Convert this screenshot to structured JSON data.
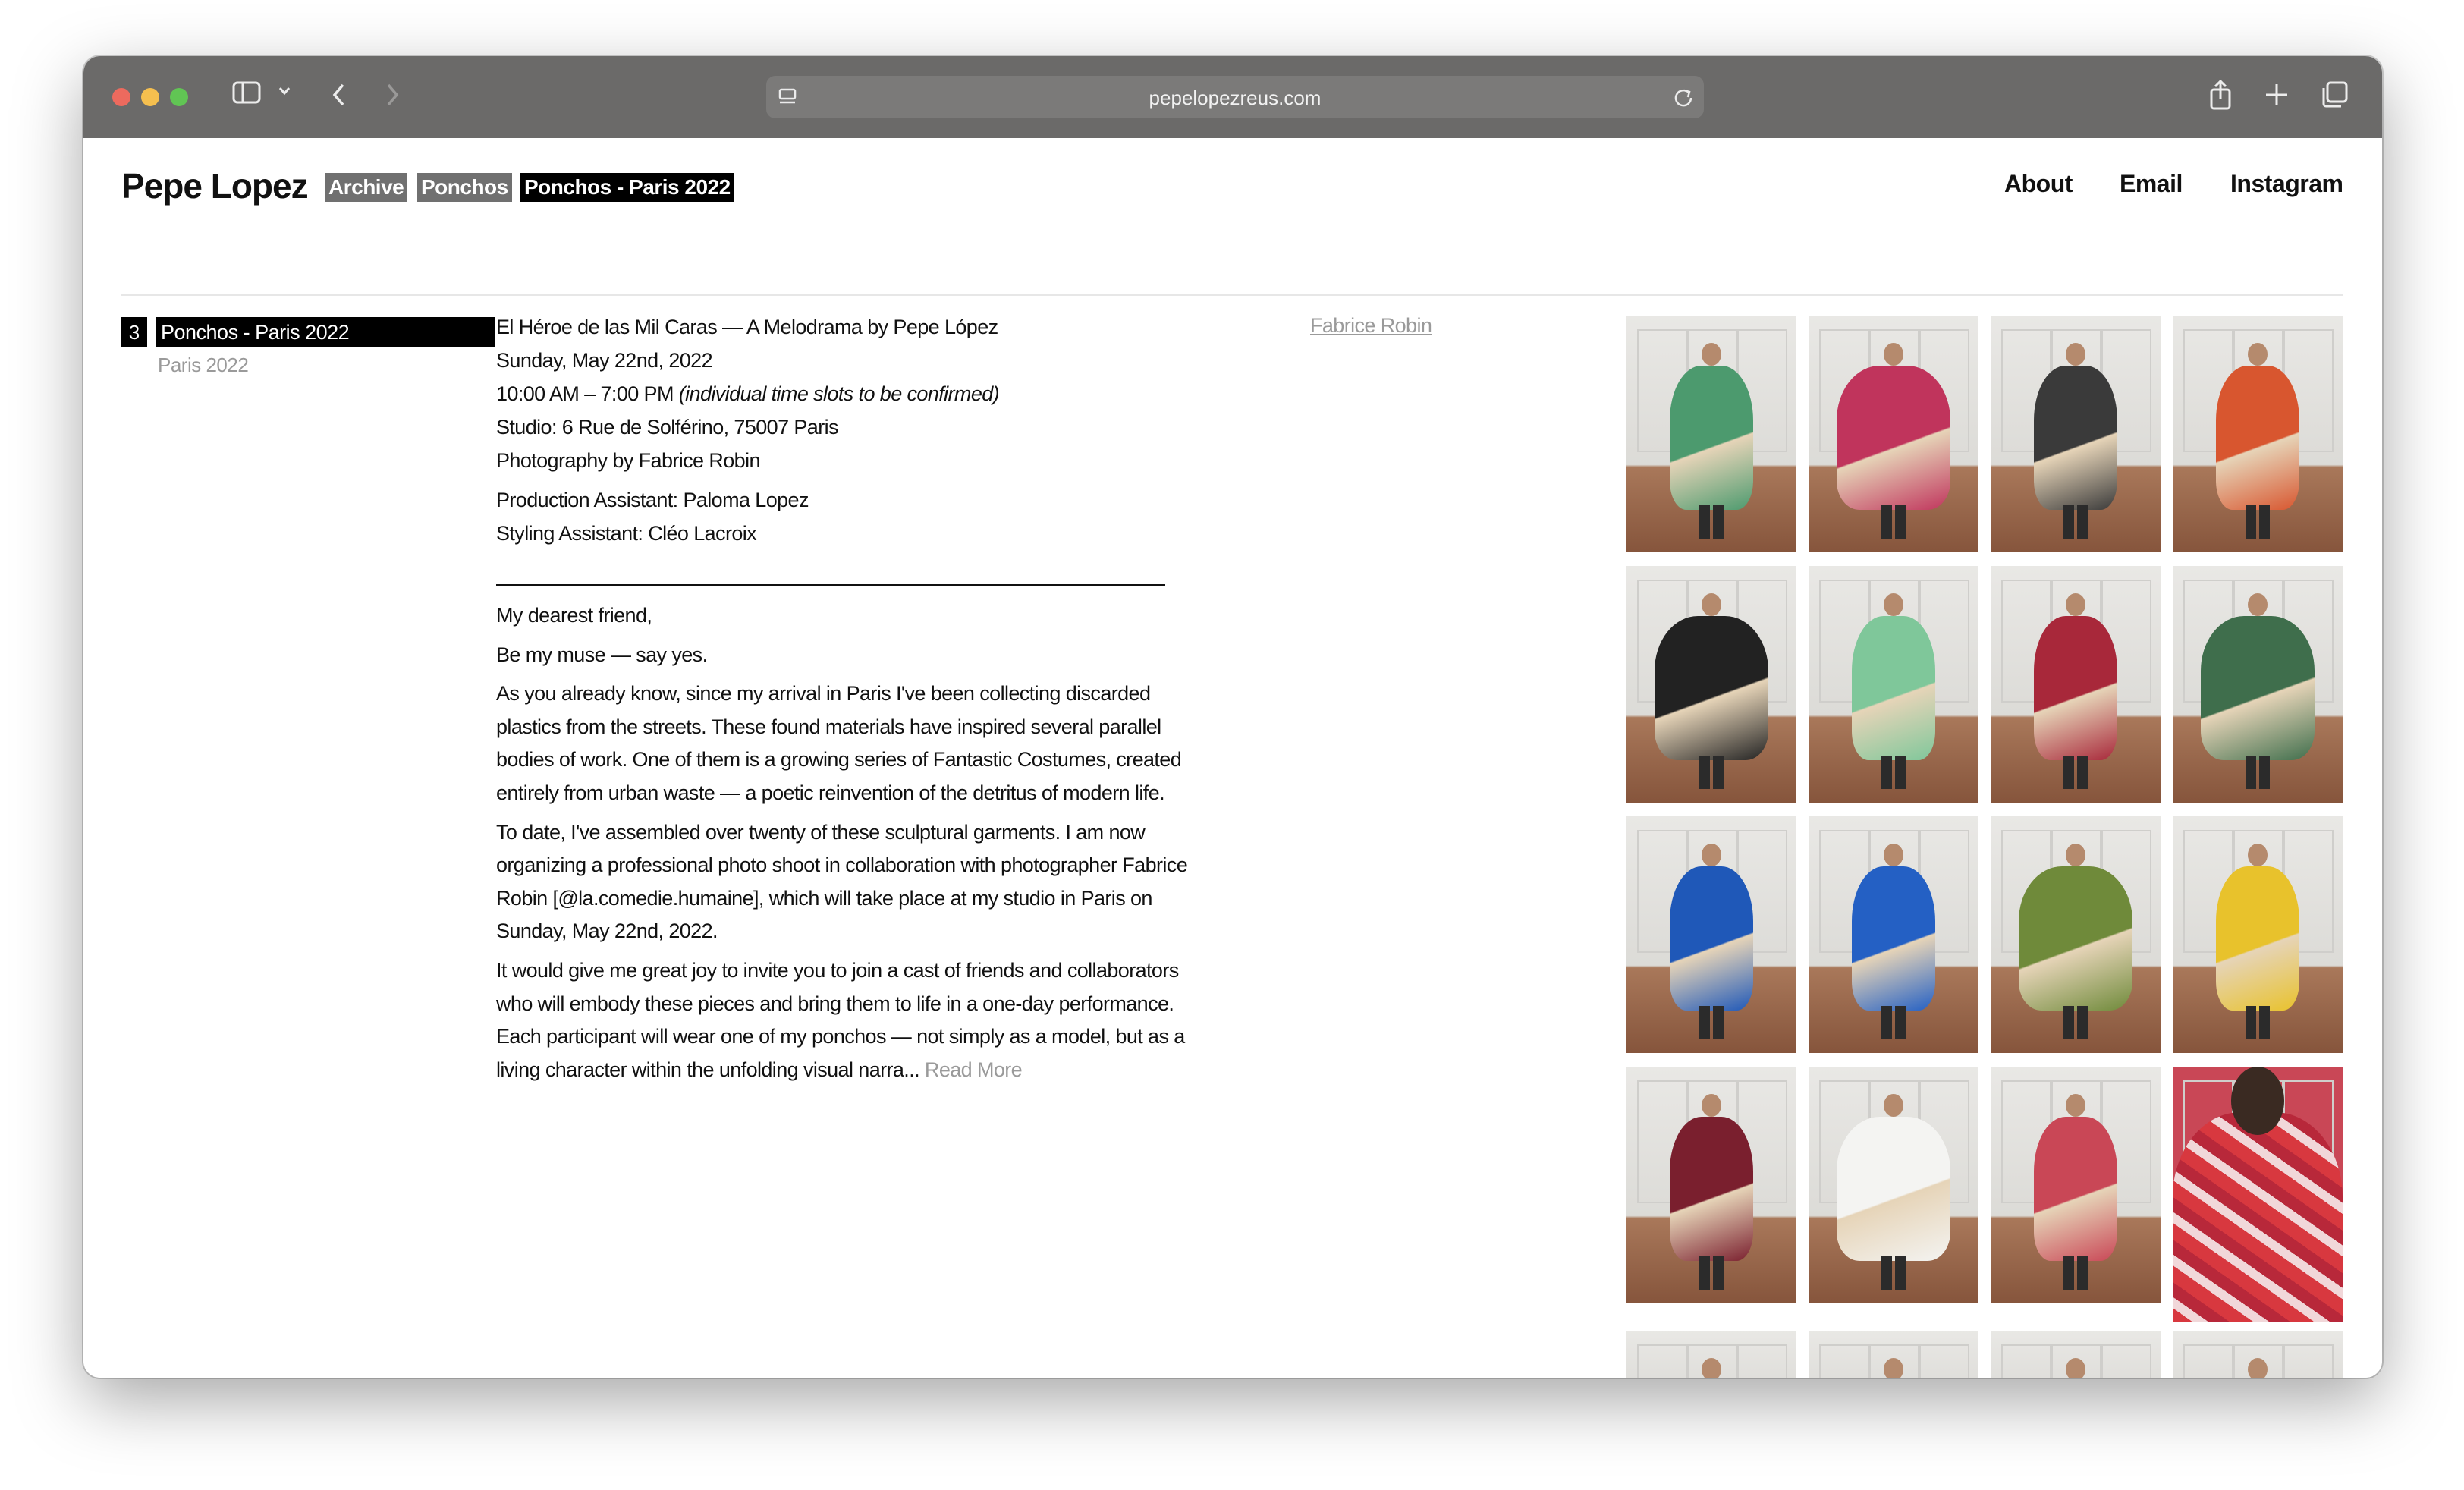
{
  "browser": {
    "url": "pepelopezreus.com",
    "icons": [
      "sidebar-icon",
      "chevron-down-icon",
      "back-icon",
      "forward-icon",
      "site-icon",
      "reload-icon",
      "share-icon",
      "new-tab-icon",
      "tabs-overview-icon"
    ]
  },
  "header": {
    "brand": "Pepe Lopez",
    "breadcrumbs": [
      "Archive",
      "Ponchos",
      "Ponchos - Paris 2022"
    ],
    "nav": [
      "About",
      "Email",
      "Instagram"
    ]
  },
  "sidebar": {
    "number": "3",
    "title": "Ponchos - Paris 2022",
    "subtitle": "Paris 2022"
  },
  "project": {
    "lines": [
      "El Héroe de las Mil Caras — A Melodrama by Pepe López",
      "Sunday, May 22nd, 2022",
      "10:00 AM – 7:00 PM",
      "Studio: 6 Rue de Solférino, 75007 Paris",
      "Photography by Fabrice Robin",
      "Production Assistant: Paloma Lopez",
      "Styling Assistant: Cléo Lacroix"
    ],
    "time_note": "(individual time slots to be confirmed)",
    "letter": [
      "My dearest friend,",
      "Be my muse — say yes.",
      "As you already know, since my arrival in Paris I've been collecting discarded plastics from the streets. These found materials have inspired several parallel bodies of work. One of them is a growing series of Fantastic Costumes, created entirely from urban waste — a poetic reinvention of the detritus of modern life.",
      "To date, I've assembled over twenty of these sculptural garments. I am now organizing a professional photo shoot in collaboration with photographer Fabrice Robin [@la.comedie.humaine], which will take place at my studio in Paris on Sunday, May 22nd, 2022.",
      "It would give me great joy to invite you to join a cast of friends and collaborators who will embody these pieces and bring them to life in a one-day performance. Each participant will wear one of my ponchos — not simply as a model, but as a living character within the unfolding visual narra..."
    ],
    "read_more": "Read More",
    "credit": "Fabrice Robin"
  },
  "colors": {
    "toolbar": "#6b6a69",
    "crumb_gray": "#707070",
    "crumb_active": "#000000",
    "muted_text": "#9a9a9a",
    "traffic_red": "#ed6a5e",
    "traffic_yellow": "#f5bf4f",
    "traffic_green": "#61c554"
  },
  "gallery": {
    "costume_colors": [
      "#4c9a6e",
      "#c0345c",
      "#3a3a3a",
      "#d8562f",
      "#222222",
      "#7fc79a",
      "#a8283a",
      "#3f6e4c",
      "#1f58b8",
      "#2460c4",
      "#6f8a3a",
      "#e8c22c",
      "#7a1f2e",
      "#f4f4f2",
      "#c94756",
      "#d8383f",
      "#c8552f",
      "#3a3a3a",
      "#5a5f60",
      "#d8384f"
    ]
  }
}
